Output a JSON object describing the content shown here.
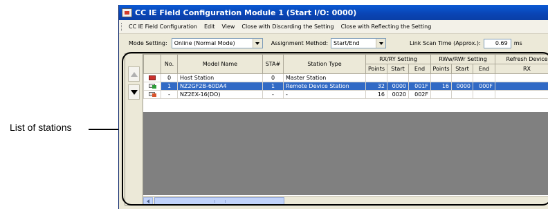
{
  "caption": "List of stations",
  "window": {
    "title": "CC IE Field Configuration Module 1 (Start I/O: 0000)"
  },
  "menu": [
    "CC IE Field Configuration",
    "Edit",
    "View",
    "Close with Discarding the Setting",
    "Close with Reflecting the Setting"
  ],
  "toolbar": {
    "mode_label": "Mode Setting:",
    "mode_value": "Online (Normal Mode)",
    "assign_label": "Assignment Method:",
    "assign_value": "Start/End",
    "scan_label": "Link Scan Time (Approx.):",
    "scan_value": "0.69",
    "scan_unit": "ms"
  },
  "table": {
    "headers": {
      "no": "No.",
      "model": "Model Name",
      "sta": "STA#",
      "type": "Station Type",
      "rxry": "RX/RY Setting",
      "rwwrwr": "RWw/RWr Setting",
      "refresh": "Refresh Device",
      "points": "Points",
      "start": "Start",
      "end": "End",
      "rx": "RX"
    },
    "rows": [
      {
        "icon": "host-station-icon",
        "no": "0",
        "model": "Host Station",
        "sta": "0",
        "type": "Master Station",
        "rx_points": "",
        "rx_start": "",
        "rx_end": "",
        "rw_points": "",
        "rw_start": "",
        "rw_end": "",
        "refresh": ""
      },
      {
        "icon": "remote-device-icon",
        "no": "1",
        "model": "NZ2GF2B-60DA4",
        "sta": "1",
        "type": "Remote Device Station",
        "rx_points": "32",
        "rx_start": "0000",
        "rx_end": "001F",
        "rw_points": "16",
        "rw_start": "0000",
        "rw_end": "000F",
        "refresh": ""
      },
      {
        "icon": "extension-module-icon",
        "no": "-",
        "model": "NZ2EX-16(DO)",
        "sta": "-",
        "type": "-",
        "rx_points": "16",
        "rx_start": "0020",
        "rx_end": "002F",
        "rw_points": "",
        "rw_start": "",
        "rw_end": "",
        "refresh": ""
      }
    ]
  },
  "colors": {
    "selection": "#316ac5",
    "titlebar": "#0a44b4",
    "empty_area": "#808080"
  }
}
